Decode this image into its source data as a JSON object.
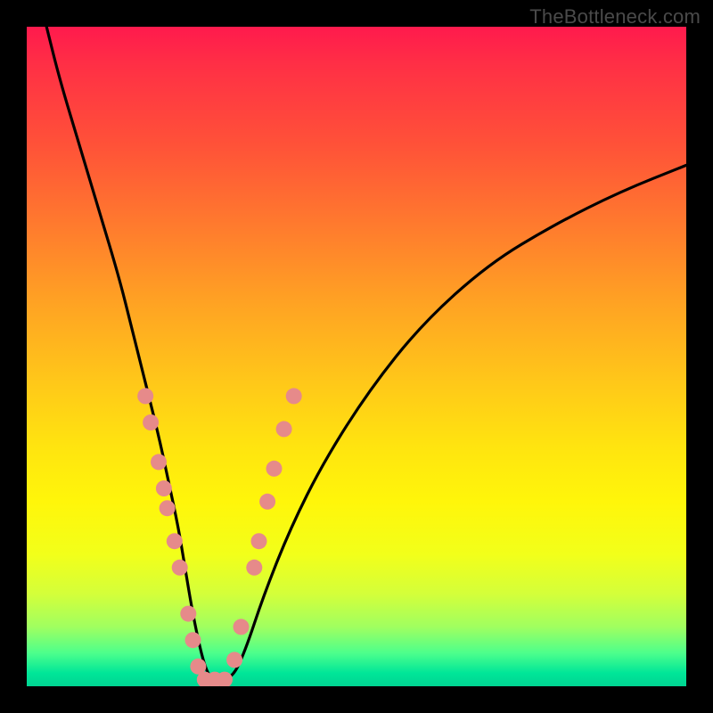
{
  "watermark": "TheBottleneck.com",
  "chart_data": {
    "type": "line",
    "title": "",
    "xlabel": "",
    "ylabel": "",
    "xlim": [
      0,
      100
    ],
    "ylim": [
      0,
      100
    ],
    "grid": false,
    "series": [
      {
        "name": "bottleneck-curve",
        "color": "#000000",
        "x": [
          3,
          5,
          8,
          11,
          14,
          16,
          18,
          20,
          21.5,
          23,
          24,
          25,
          26,
          27,
          28,
          31,
          33,
          36,
          40,
          45,
          52,
          60,
          70,
          80,
          90,
          100
        ],
        "y": [
          100,
          92,
          82,
          72,
          62,
          54,
          46,
          38,
          31,
          24,
          18,
          12,
          7,
          3,
          1,
          1,
          5,
          14,
          24,
          34,
          45,
          55,
          64,
          70,
          75,
          79
        ]
      }
    ],
    "markers": [
      {
        "name": "highlight-points",
        "color": "#e68a8a",
        "radius_px": 9,
        "points": [
          {
            "x": 18.0,
            "y": 44
          },
          {
            "x": 18.8,
            "y": 40
          },
          {
            "x": 20.0,
            "y": 34
          },
          {
            "x": 20.8,
            "y": 30
          },
          {
            "x": 21.3,
            "y": 27
          },
          {
            "x": 22.4,
            "y": 22
          },
          {
            "x": 23.2,
            "y": 18
          },
          {
            "x": 24.5,
            "y": 11
          },
          {
            "x": 25.2,
            "y": 7
          },
          {
            "x": 26.0,
            "y": 3
          },
          {
            "x": 27.0,
            "y": 1
          },
          {
            "x": 28.5,
            "y": 1
          },
          {
            "x": 30.0,
            "y": 1
          },
          {
            "x": 31.5,
            "y": 4
          },
          {
            "x": 32.5,
            "y": 9
          },
          {
            "x": 34.5,
            "y": 18
          },
          {
            "x": 35.2,
            "y": 22
          },
          {
            "x": 36.5,
            "y": 28
          },
          {
            "x": 37.5,
            "y": 33
          },
          {
            "x": 39.0,
            "y": 39
          },
          {
            "x": 40.5,
            "y": 44
          }
        ]
      }
    ]
  }
}
